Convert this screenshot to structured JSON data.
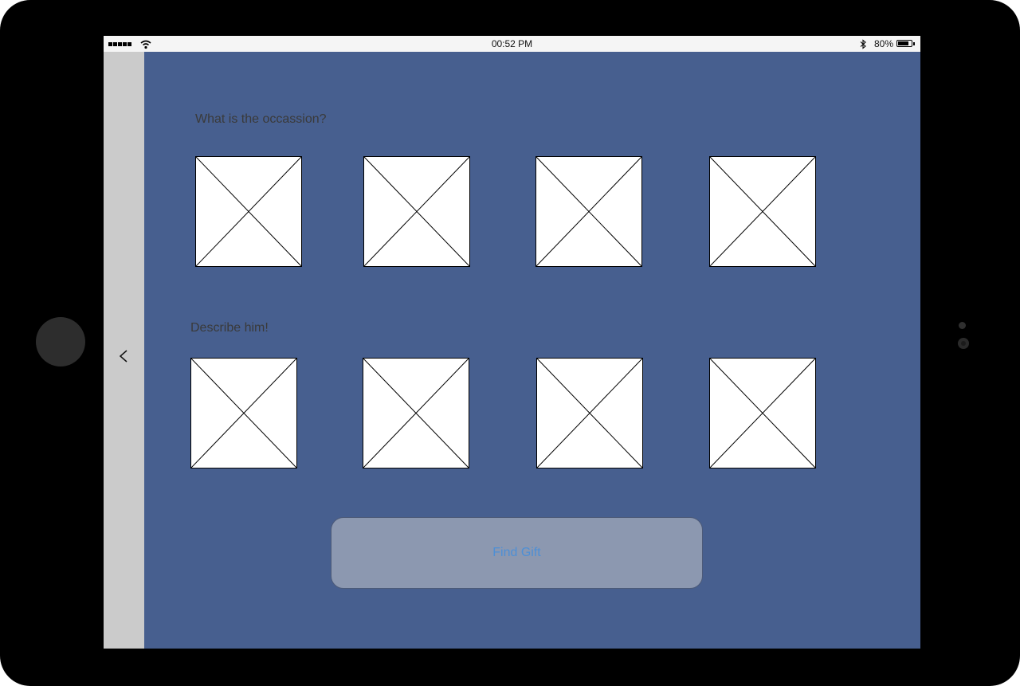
{
  "status_bar": {
    "time": "00:52 PM",
    "battery_percent": "80%",
    "battery_level": 0.8,
    "signal_bars": 5,
    "icons": [
      "signal-icon",
      "wifi-icon",
      "bluetooth-icon",
      "battery-icon"
    ]
  },
  "navigation": {
    "back_icon": "chevron-left-icon"
  },
  "occasion_section": {
    "label": "What is the occassion?",
    "tiles": [
      "image-placeholder",
      "image-placeholder",
      "image-placeholder",
      "image-placeholder"
    ]
  },
  "describe_section": {
    "label": "Describe him!",
    "tiles": [
      "image-placeholder",
      "image-placeholder",
      "image-placeholder",
      "image-placeholder"
    ]
  },
  "action": {
    "find_gift_label": "Find Gift"
  },
  "colors": {
    "screen_background": "#475f8f",
    "side_panel": "#cbcbcb",
    "button_background": "#8c98b0",
    "button_text": "#4d8fd6",
    "label_text": "#3a3a3a"
  }
}
